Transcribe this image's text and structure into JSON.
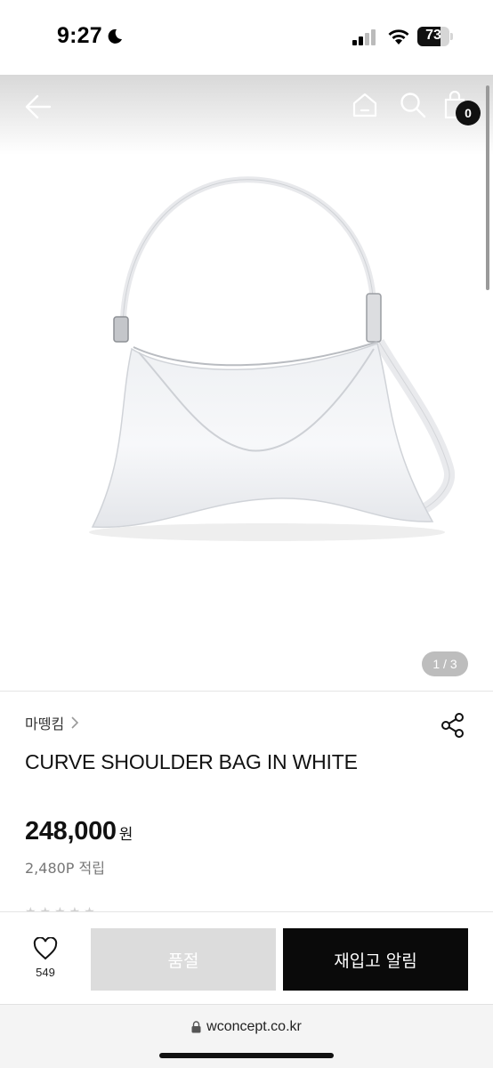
{
  "status_bar": {
    "time": "9:27",
    "battery_level": "73",
    "battery_fraction": 0.73
  },
  "gallery": {
    "cart_count": "0",
    "page_counter": "1 / 3",
    "icons": [
      "back-arrow-icon",
      "home-icon",
      "search-icon",
      "cart-icon"
    ]
  },
  "product": {
    "brand": "마뗑킴",
    "title": "CURVE SHOULDER BAG IN WHITE",
    "price": "248,000",
    "price_unit": "원",
    "points": "2,480P 적립"
  },
  "actions": {
    "like_count": "549",
    "soldout_label": "품절",
    "restock_label": "재입고 알림"
  },
  "browser": {
    "url": "wconcept.co.kr"
  }
}
